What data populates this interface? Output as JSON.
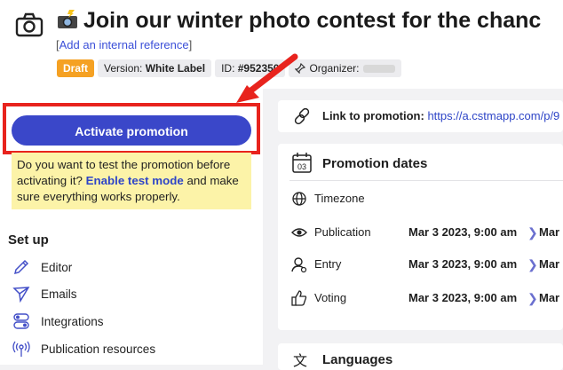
{
  "header": {
    "title": "Join our winter photo contest for the chanc",
    "internal_ref": "Add an internal reference",
    "badges": {
      "status": "Draft",
      "version_label": "Version:",
      "version_value": "White Label",
      "id_label": "ID:",
      "id_value": "#952350",
      "organizer_label": "Organizer:"
    }
  },
  "sidebar": {
    "activate_label": "Activate promotion",
    "test_note": {
      "before": "Do you want to test the promotion before activating it?",
      "link": "Enable test mode",
      "after": "and make sure everything works properly."
    },
    "setup_heading": "Set up",
    "items": [
      {
        "label": "Editor",
        "icon": "pencil-icon"
      },
      {
        "label": "Emails",
        "icon": "send-icon"
      },
      {
        "label": "Integrations",
        "icon": "toggle-icon"
      },
      {
        "label": "Publication resources",
        "icon": "broadcast-icon"
      }
    ]
  },
  "main": {
    "link": {
      "label": "Link to promotion:",
      "url": "https://a.cstmapp.com/p/9"
    },
    "dates": {
      "heading": "Promotion dates",
      "calendar_day": "03",
      "rows": [
        {
          "label": "Timezone",
          "value": "",
          "value2": "",
          "icon": "globe-icon"
        },
        {
          "label": "Publication",
          "value": "Mar 3 2023, 9:00 am",
          "value2": "Mar",
          "icon": "eye-icon"
        },
        {
          "label": "Entry",
          "value": "Mar 3 2023, 9:00 am",
          "value2": "Mar",
          "icon": "user-icon"
        },
        {
          "label": "Voting",
          "value": "Mar 3 2023, 9:00 am",
          "value2": "Mar",
          "icon": "thumbs-up-icon"
        }
      ]
    },
    "languages": {
      "heading": "Languages"
    }
  },
  "colors": {
    "accent": "#3a47c9",
    "draft": "#f5a123",
    "highlight_border": "#e8231d",
    "note_bg": "#fcf3a8"
  }
}
